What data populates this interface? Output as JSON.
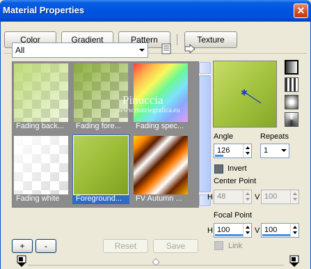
{
  "window": {
    "title": "Material Properties",
    "close_label": "✕"
  },
  "tabs": [
    {
      "label": "Color",
      "active": false
    },
    {
      "label": "Gradient",
      "active": true
    },
    {
      "label": "Pattern",
      "active": false
    },
    {
      "label": "Texture",
      "active": false
    }
  ],
  "library": {
    "category_value": "All",
    "thumbnails": [
      {
        "caption": "Fading back...",
        "selected": false
      },
      {
        "caption": "Fading fore...",
        "selected": false
      },
      {
        "caption": "Fading spec...",
        "selected": false
      },
      {
        "caption": "Fading white",
        "selected": false
      },
      {
        "caption": "Foreground...",
        "selected": true
      },
      {
        "caption": "FV Autumn ...",
        "selected": false
      }
    ],
    "add_label": "+",
    "remove_label": "-",
    "reset_label": "Reset",
    "save_label": "Save"
  },
  "watermark": {
    "line1": "Pinuccia",
    "line2": "www.matriegrafica.eu"
  },
  "properties": {
    "angle_label": "Angle",
    "angle_value": "126",
    "repeats_label": "Repeats",
    "repeats_value": "1",
    "invert_label": "Invert",
    "invert_checked": true,
    "center_point_label": "Center Point",
    "center_h_label": "H",
    "center_h_value": "48",
    "center_v_label": "V",
    "center_v_value": "100",
    "focal_point_label": "Focal Point",
    "focal_h_label": "H",
    "focal_h_value": "100",
    "focal_v_label": "V",
    "focal_v_value": "100",
    "link_label": "Link",
    "link_checked": false
  },
  "colors": {
    "accent": "#316ac5",
    "gradient_light": "#c8dc6a",
    "gradient_dark": "#86a828"
  }
}
